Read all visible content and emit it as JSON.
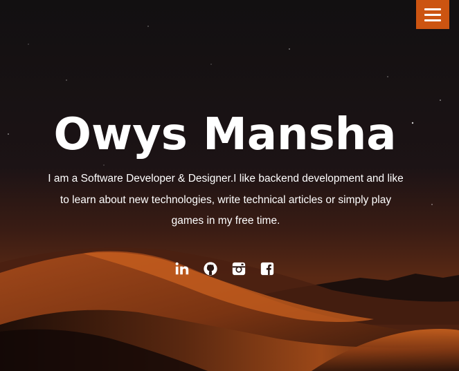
{
  "header": {
    "menu_icon": "hamburger-menu-icon",
    "accent_color": "#cc5411"
  },
  "hero": {
    "name": "Owys Mansha",
    "bio": "I am a Software Developer & Designer.I like backend development and like to learn about new technologies, write technical articles or simply play games in my free time.",
    "background": "desert-dunes-night-sky"
  },
  "socials": [
    {
      "icon": "linkedin-icon"
    },
    {
      "icon": "github-icon"
    },
    {
      "icon": "instagram-icon"
    },
    {
      "icon": "facebook-icon"
    }
  ]
}
